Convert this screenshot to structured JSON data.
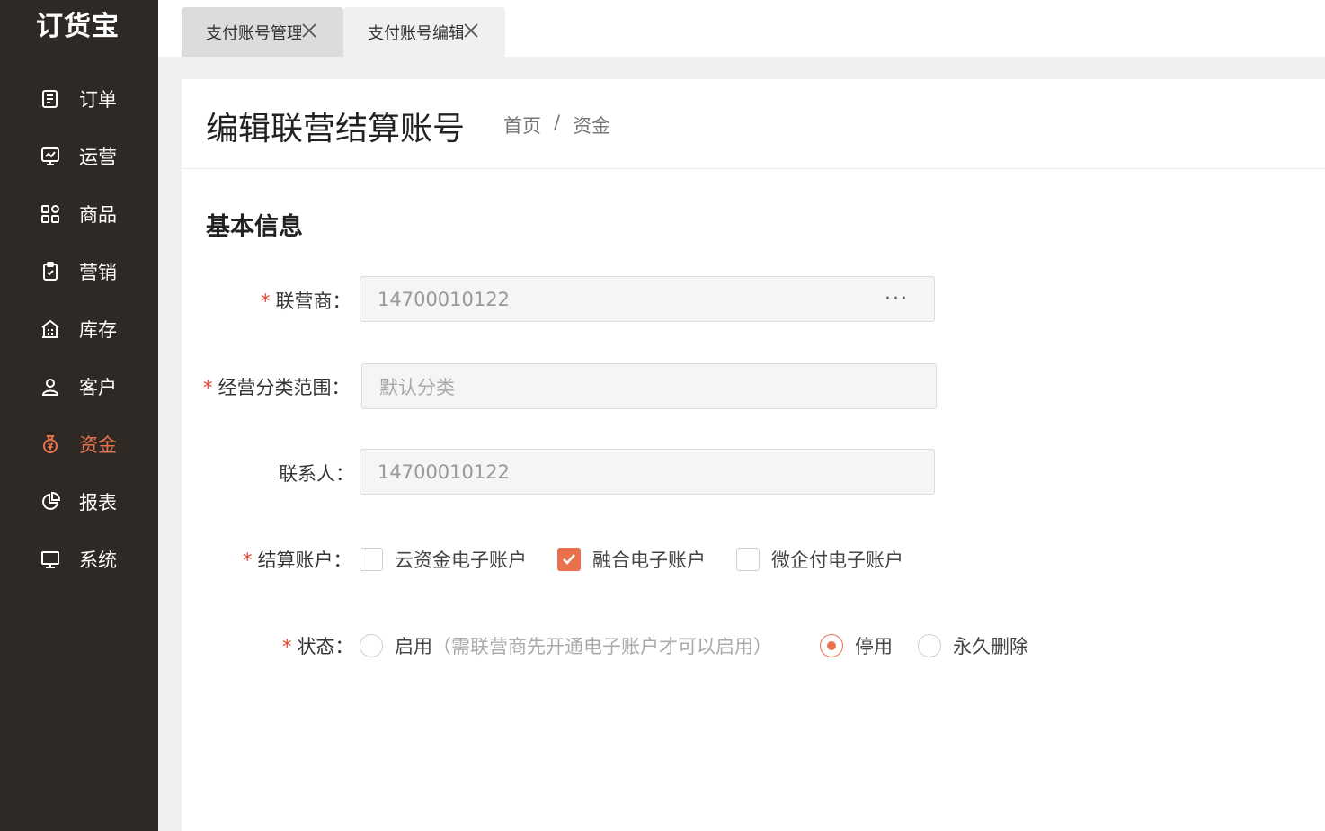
{
  "app": {
    "logo": "订货宝"
  },
  "sidebar": {
    "items": [
      {
        "label": "订单",
        "icon": "order-icon"
      },
      {
        "label": "运营",
        "icon": "operation-chart-icon"
      },
      {
        "label": "商品",
        "icon": "product-grid-icon"
      },
      {
        "label": "营销",
        "icon": "marketing-clipboard-icon"
      },
      {
        "label": "库存",
        "icon": "warehouse-icon"
      },
      {
        "label": "客户",
        "icon": "customer-user-icon"
      },
      {
        "label": "资金",
        "icon": "money-bag-icon",
        "active": true
      },
      {
        "label": "报表",
        "icon": "report-pie-icon"
      },
      {
        "label": "系统",
        "icon": "system-monitor-icon"
      }
    ],
    "active_color": "#e8714e"
  },
  "tabs": [
    {
      "label": "支付账号管理",
      "active": false
    },
    {
      "label": "支付账号编辑",
      "active": true
    }
  ],
  "header": {
    "title": "编辑联营结算账号",
    "breadcrumb": [
      "首页",
      "/",
      "资金"
    ]
  },
  "section": {
    "title": "基本信息"
  },
  "form": {
    "partner": {
      "label": "联营商",
      "required": true,
      "value": "14700010122",
      "more": "···"
    },
    "category": {
      "label": "经营分类范围",
      "required": true,
      "placeholder": "默认分类"
    },
    "contact": {
      "label": "联系人",
      "required": false,
      "value": "14700010122"
    },
    "account": {
      "label": "结算账户",
      "required": true,
      "options": [
        {
          "label": "云资金电子账户",
          "checked": false
        },
        {
          "label": "融合电子账户",
          "checked": true
        },
        {
          "label": "微企付电子账户",
          "checked": false
        }
      ]
    },
    "status": {
      "label": "状态",
      "required": true,
      "options": [
        {
          "label": "启用",
          "hint": "（需联营商先开通电子账户才可以启用）",
          "checked": false
        },
        {
          "label": "停用",
          "checked": true
        },
        {
          "label": "永久删除",
          "checked": false
        }
      ]
    },
    "colon": "："
  }
}
